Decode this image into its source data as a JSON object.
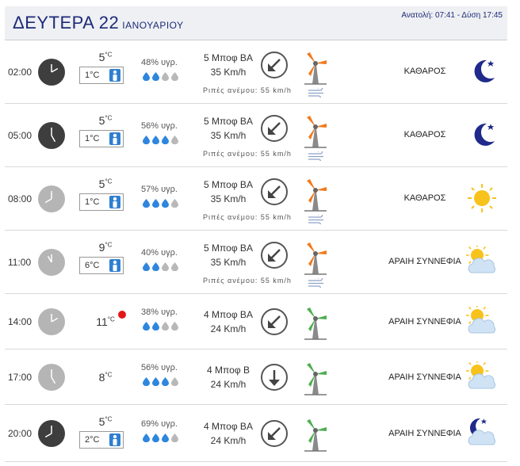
{
  "header": {
    "day": "ΔΕΥΤΕΡΑ 22",
    "month": "ΙΑΝΟΥΑΡΙΟΥ",
    "sun_times": "Ανατολή: 07:41  - Δύση 17:45"
  },
  "rows": [
    {
      "time": "02:00",
      "temp": "5",
      "temp_unit": "°C",
      "feels": "1°C",
      "humidity": "48% υγρ.",
      "drops_filled": 2,
      "wind_bf": "5 Μποφ ΒΑ",
      "wind_kmh": "35 Km/h",
      "gust": "Ριπές ανέμου: 55 km/h",
      "sky": "ΚΑΘΑΡΟΣ",
      "clock_color": "dark",
      "turbine": "orange",
      "weather_icon": "moon-icon",
      "arrow": "arrow-southwest-icon"
    },
    {
      "time": "05:00",
      "temp": "5",
      "temp_unit": "°C",
      "feels": "1°C",
      "humidity": "56% υγρ.",
      "drops_filled": 3,
      "wind_bf": "5 Μποφ ΒΑ",
      "wind_kmh": "35 Km/h",
      "gust": "Ριπές ανέμου: 55 km/h",
      "sky": "ΚΑΘΑΡΟΣ",
      "clock_color": "dark",
      "turbine": "orange",
      "weather_icon": "moon-icon",
      "arrow": "arrow-southwest-icon"
    },
    {
      "time": "08:00",
      "temp": "5",
      "temp_unit": "°C",
      "feels": "1°C",
      "humidity": "57% υγρ.",
      "drops_filled": 3,
      "wind_bf": "5 Μποφ ΒΑ",
      "wind_kmh": "35 Km/h",
      "gust": "Ριπές ανέμου: 55 km/h",
      "sky": "ΚΑΘΑΡΟΣ",
      "clock_color": "light",
      "turbine": "orange",
      "weather_icon": "sun-icon",
      "arrow": "arrow-southwest-icon"
    },
    {
      "time": "11:00",
      "temp": "9",
      "temp_unit": "°C",
      "feels": "6°C",
      "humidity": "40% υγρ.",
      "drops_filled": 2,
      "wind_bf": "5 Μποφ ΒΑ",
      "wind_kmh": "35 Km/h",
      "gust": "Ριπές ανέμου: 55 km/h",
      "sky": "ΑΡΑΙΗ ΣΥΝΝΕΦΙΑ",
      "clock_color": "light",
      "turbine": "orange",
      "weather_icon": "sun-cloud-icon",
      "arrow": "arrow-southwest-icon"
    },
    {
      "time": "14:00",
      "temp": "11",
      "temp_unit": "°C",
      "feels": "",
      "humidity": "38% υγρ.",
      "drops_filled": 2,
      "wind_bf": "4 Μποφ ΒΑ",
      "wind_kmh": "24 Km/h",
      "gust": "",
      "sky": "ΑΡΑΙΗ ΣΥΝΝΕΦΙΑ",
      "clock_color": "light",
      "turbine": "green",
      "weather_icon": "sun-cloud-icon",
      "arrow": "arrow-southwest-icon",
      "hot": true
    },
    {
      "time": "17:00",
      "temp": "8",
      "temp_unit": "°C",
      "feels": "",
      "humidity": "56% υγρ.",
      "drops_filled": 3,
      "wind_bf": "4 Μποφ Β",
      "wind_kmh": "24 Km/h",
      "gust": "",
      "sky": "ΑΡΑΙΗ ΣΥΝΝΕΦΙΑ",
      "clock_color": "light",
      "turbine": "green",
      "weather_icon": "sun-cloud-icon",
      "arrow": "arrow-south-icon"
    },
    {
      "time": "20:00",
      "temp": "5",
      "temp_unit": "°C",
      "feels": "2°C",
      "humidity": "69% υγρ.",
      "drops_filled": 3,
      "wind_bf": "4 Μποφ ΒΑ",
      "wind_kmh": "24 Km/h",
      "gust": "",
      "sky": "ΑΡΑΙΗ ΣΥΝΝΕΦΙΑ",
      "clock_color": "dark",
      "turbine": "green",
      "weather_icon": "moon-cloud-icon",
      "arrow": "arrow-southwest-icon"
    }
  ],
  "colors": {
    "accent": "#1e2a78",
    "drop_filled": "#2e86de",
    "drop_empty": "#b8b8b8",
    "turbine_orange": "#f07a1e",
    "turbine_green": "#4caf50",
    "moon": "#1f2a8a",
    "sun": "#f8c21c"
  }
}
